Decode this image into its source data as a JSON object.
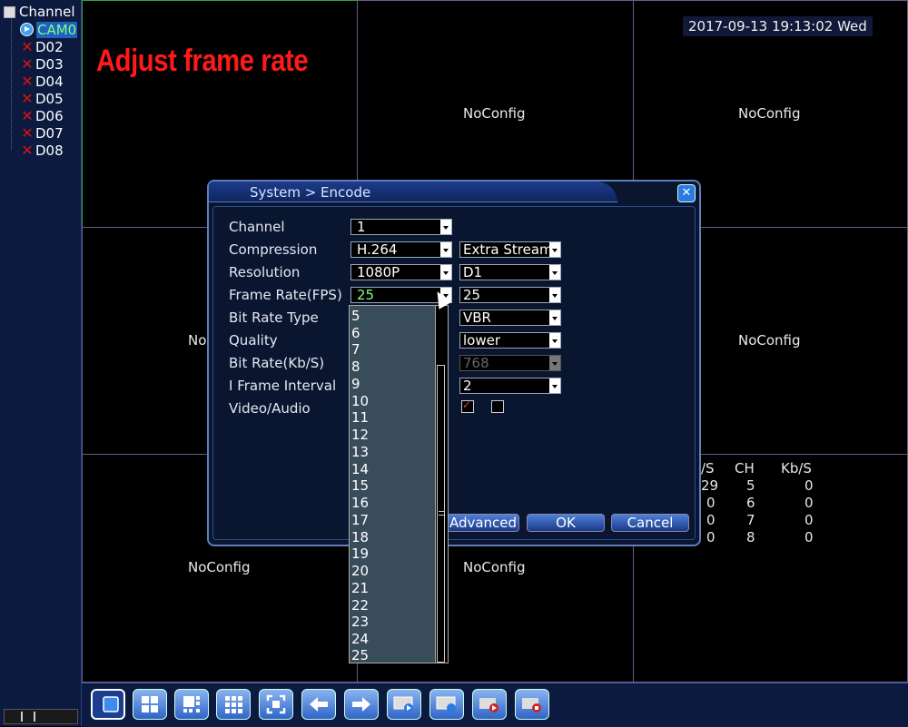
{
  "sidebar": {
    "root_label": "Channel",
    "channels": [
      {
        "label": "CAM0",
        "state": "active"
      },
      {
        "label": "D02",
        "state": "error"
      },
      {
        "label": "D03",
        "state": "error"
      },
      {
        "label": "D04",
        "state": "error"
      },
      {
        "label": "D05",
        "state": "error"
      },
      {
        "label": "D06",
        "state": "error"
      },
      {
        "label": "D07",
        "state": "error"
      },
      {
        "label": "D08",
        "state": "error"
      }
    ]
  },
  "overlay": {
    "datetime": "2017-09-13 19:13:02 Wed",
    "banner": "Adjust frame rate",
    "noconfig": "NoConfig",
    "noconfig_partial": "No"
  },
  "stats": {
    "headers": [
      "/S",
      "CH",
      "Kb/S"
    ],
    "rows": [
      [
        "29",
        "5",
        "0"
      ],
      [
        "0",
        "6",
        "0"
      ],
      [
        "0",
        "7",
        "0"
      ],
      [
        "0",
        "8",
        "0"
      ]
    ]
  },
  "dialog": {
    "title": "System > Encode",
    "labels": {
      "channel": "Channel",
      "compression": "Compression",
      "resolution": "Resolution",
      "frame_rate": "Frame Rate(FPS)",
      "bit_rate_type": "Bit Rate Type",
      "quality": "Quality",
      "bit_rate": "Bit Rate(Kb/S)",
      "i_frame": "I Frame Interval",
      "video_audio": "Video/Audio"
    },
    "main": {
      "channel": "1",
      "compression": "H.264",
      "resolution": "1080P",
      "frame_rate": "25"
    },
    "extra": {
      "compression": "Extra Stream",
      "resolution": "D1",
      "frame_rate": "25",
      "bit_rate_type": "VBR",
      "quality": "lower",
      "bit_rate": "768",
      "i_frame": "2",
      "video_checked": true,
      "audio_checked": false
    },
    "fps_options": [
      "5",
      "6",
      "7",
      "8",
      "9",
      "10",
      "11",
      "12",
      "13",
      "14",
      "15",
      "16",
      "17",
      "18",
      "19",
      "20",
      "21",
      "22",
      "23",
      "24",
      "25"
    ],
    "buttons": {
      "advanced": "Advanced",
      "ok": "OK",
      "cancel": "Cancel"
    }
  },
  "colors": {
    "banner": "#ff1a1a",
    "selected_value": "#80ff80",
    "accent": "#2f64c8"
  },
  "toolbar": {
    "icons": [
      "single-view-icon",
      "quad-view-icon",
      "eight-view-icon",
      "nine-view-icon",
      "fullscreen-icon",
      "previous-icon",
      "next-icon",
      "playback-icon",
      "record-icon",
      "record-control-icon",
      "alarm-icon"
    ]
  }
}
